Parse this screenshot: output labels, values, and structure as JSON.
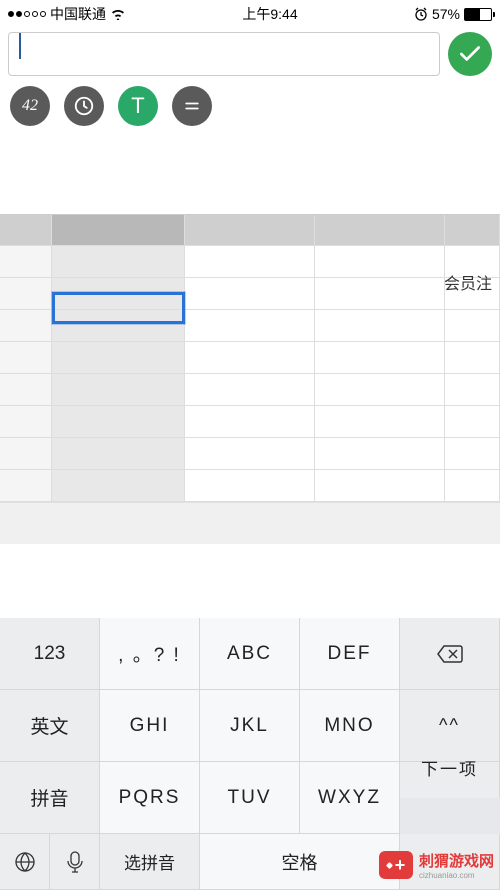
{
  "status": {
    "carrier": "中国联通",
    "time": "上午9:44",
    "battery_pct": "57%"
  },
  "input": {
    "value": "",
    "placeholder": ""
  },
  "tools": {
    "number": "42",
    "clock": "clock",
    "text": "T",
    "menu": "menu"
  },
  "sheet": {
    "label": "会员注"
  },
  "keyboard": {
    "row1": {
      "k1": "123",
      "k2": ", 。? !",
      "k3": "ABC",
      "k4": "DEF"
    },
    "row2": {
      "k1": "英文",
      "k2": "GHI",
      "k3": "JKL",
      "k4": "MNO",
      "k5": "^^"
    },
    "row3": {
      "k1": "拼音",
      "k2": "PQRS",
      "k3": "TUV",
      "k4": "WXYZ",
      "k5": "下一项"
    },
    "row4": {
      "select": "选拼音",
      "space": "空格"
    }
  },
  "watermark": {
    "cn": "刺猬游戏网",
    "en": "cizhuaniao.com"
  }
}
